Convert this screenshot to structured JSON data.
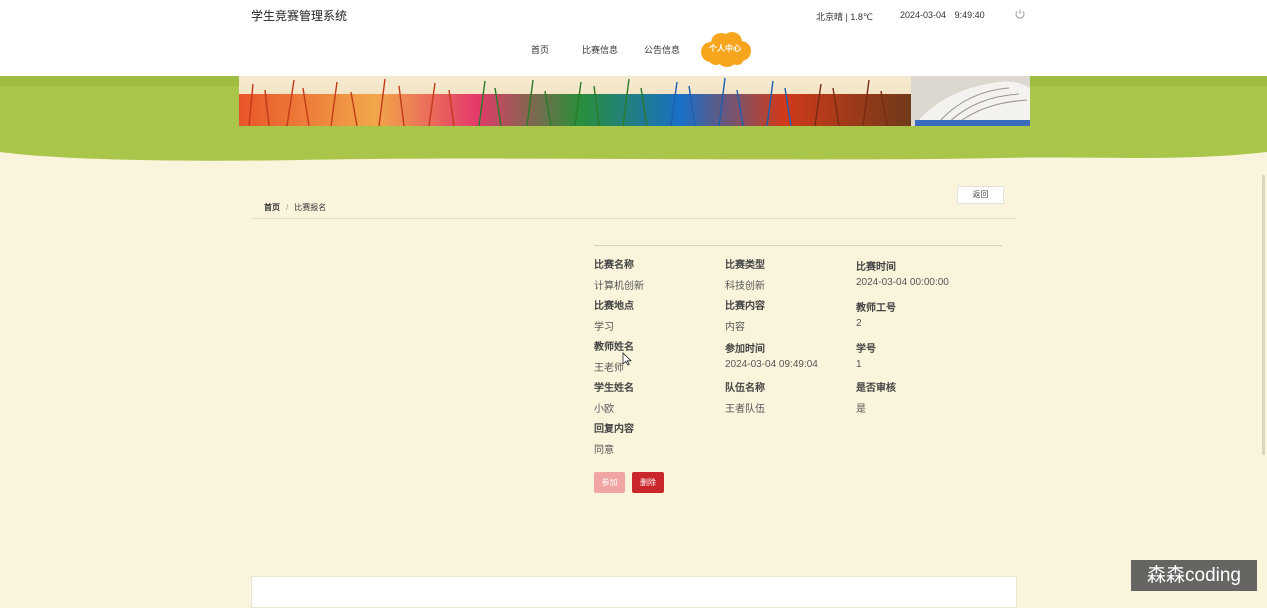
{
  "header": {
    "site_title": "学生竞赛管理系统",
    "weather": "北京晴 | 1.8℃",
    "date": "2024-03-04",
    "time": "9:49:40",
    "power_icon": "power-icon"
  },
  "nav": {
    "items": [
      "首页",
      "比赛信息",
      "公告信息"
    ],
    "active": "个人中心"
  },
  "breadcrumb": {
    "home": "首页",
    "separator": "/",
    "current": "比赛报名",
    "back_label": "返回"
  },
  "detail": {
    "fields": [
      {
        "label": "比赛名称",
        "value": "计算机创新"
      },
      {
        "label": "比赛类型",
        "value": "科技创新"
      },
      {
        "label": "比赛时间",
        "value": "2024-03-04 00:00:00"
      },
      {
        "label": "比赛地点",
        "value": "学习"
      },
      {
        "label": "比赛内容",
        "value": "内容"
      },
      {
        "label": "教师工号",
        "value": "2"
      },
      {
        "label": "教师姓名",
        "value": "王老师"
      },
      {
        "label": "参加时间",
        "value": "2024-03-04 09:49:04"
      },
      {
        "label": "学号",
        "value": "1"
      },
      {
        "label": "学生姓名",
        "value": "小欧"
      },
      {
        "label": "队伍名称",
        "value": "王者队伍"
      },
      {
        "label": "是否审核",
        "value": "是"
      },
      {
        "label": "回复内容",
        "value": "同意"
      }
    ],
    "join_label": "参加",
    "delete_label": "删除"
  },
  "watermark": "森森coding",
  "colors": {
    "page_bg": "#fbf4dc",
    "banner_green": "#a9c54a",
    "cloud_orange": "#f7a51d",
    "delete_red": "#c9272c",
    "join_pink": "#f0a4a4"
  }
}
